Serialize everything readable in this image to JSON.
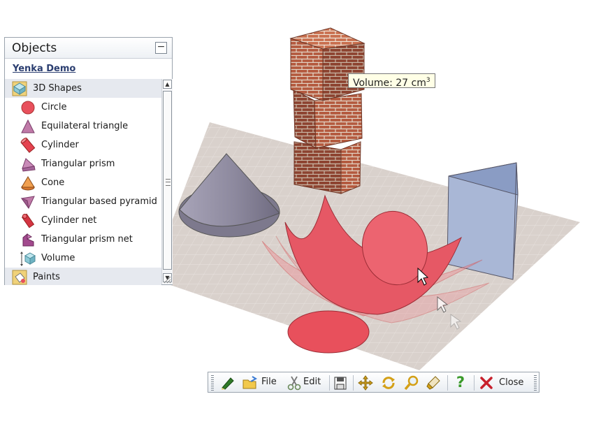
{
  "panel": {
    "title": "Objects",
    "collapse_symbol": "−",
    "demo_link": "Yenka Demo",
    "categories": [
      {
        "label": "3D Shapes",
        "icon": "3d-shapes-category-icon"
      },
      {
        "label": "Paints",
        "icon": "paints-category-icon"
      }
    ],
    "items": [
      {
        "label": "Circle",
        "icon": "circle-icon"
      },
      {
        "label": "Equilateral triangle",
        "icon": "triangle-icon"
      },
      {
        "label": "Cylinder",
        "icon": "cylinder-icon"
      },
      {
        "label": "Triangular prism",
        "icon": "triangular-prism-icon"
      },
      {
        "label": "Cone",
        "icon": "cone-icon"
      },
      {
        "label": "Triangular based pyramid",
        "icon": "pyramid-icon"
      },
      {
        "label": "Cylinder net",
        "icon": "cylinder-net-icon"
      },
      {
        "label": "Triangular prism net",
        "icon": "prism-net-icon"
      },
      {
        "label": "Volume",
        "icon": "volume-icon"
      }
    ]
  },
  "tooltip": {
    "text": "Volume: 27 cm",
    "superscript": "3"
  },
  "toolbar": {
    "file_label": "File",
    "edit_label": "Edit",
    "close_label": "Close",
    "help_symbol": "?"
  },
  "colors": {
    "accent_red": "#e8505c",
    "floor": "#d8d0cb",
    "prism_blue": "#9aaccf",
    "cone_gray": "#8e8a9e",
    "brick": "#b5553a"
  }
}
